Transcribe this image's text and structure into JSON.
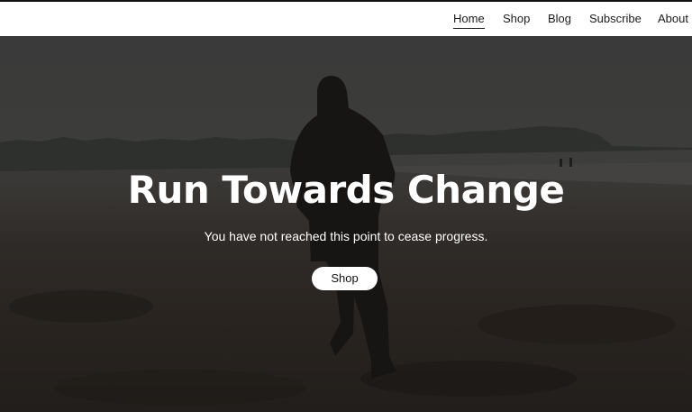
{
  "nav": {
    "items": [
      {
        "label": "Home",
        "active": true
      },
      {
        "label": "Shop",
        "active": false
      },
      {
        "label": "Blog",
        "active": false
      },
      {
        "label": "Subscribe",
        "active": false
      },
      {
        "label": "About",
        "active": false
      }
    ]
  },
  "hero": {
    "title": "Run Towards Change",
    "subtitle": "You have not reached this point to cease progress.",
    "button_label": "Shop"
  }
}
